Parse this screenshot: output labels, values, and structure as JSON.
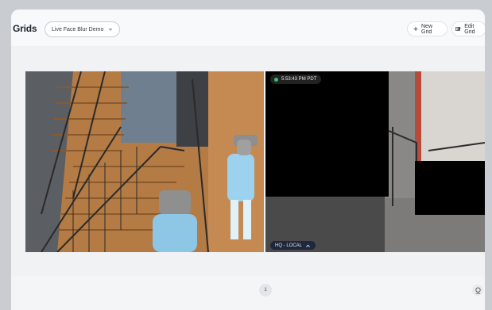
{
  "header": {
    "title": "Grids",
    "grid_select": {
      "value": "Live Face Blur Demo"
    },
    "new_grid_label": "New Grid",
    "edit_grid_label": "Edit Grid"
  },
  "cameras": [
    {
      "id": "stairwell-camera"
    },
    {
      "timestamp": "5:53:43 PM PDT",
      "location": "HQ - LOCAL",
      "status_color": "#38c172"
    }
  ],
  "pagination": {
    "current_page": "1"
  },
  "icons": [
    "chevron-down-icon",
    "plus-icon",
    "edit-grid-icon",
    "chevron-up-icon",
    "feedback-icon"
  ]
}
